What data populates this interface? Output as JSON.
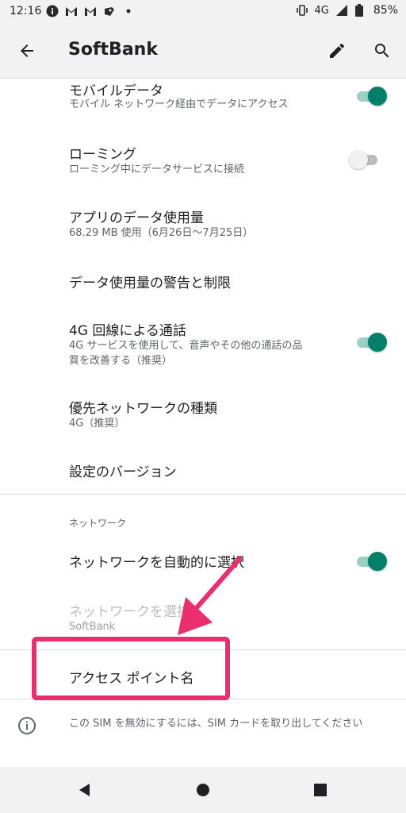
{
  "status_bar": {
    "time": "12:16",
    "network": "4G",
    "battery": "85%"
  },
  "app_bar": {
    "title": "SoftBank"
  },
  "settings": {
    "mobile_data": {
      "title": "モバイルデータ",
      "summary": "モバイル ネットワーク経由でデータにアクセス",
      "enabled": true
    },
    "roaming": {
      "title": "ローミング",
      "summary": "ローミング中にデータサービスに接続",
      "enabled": false
    },
    "app_data_usage": {
      "title": "アプリのデータ使用量",
      "summary": "68.29 MB 使用（6月26日〜7月25日）"
    },
    "data_warning": {
      "title": "データ使用量の警告と制限"
    },
    "volte": {
      "title": "4G 回線による通話",
      "summary_line1": "4G サービスを使用して、音声やその他の通話の品",
      "summary_line2": "質を改善する（推奨）",
      "enabled": true
    },
    "preferred_network": {
      "title": "優先ネットワークの種類",
      "summary": "4G（推奨）"
    },
    "settings_version": {
      "title": "設定のバージョン"
    }
  },
  "network_section": {
    "header": "ネットワーク",
    "auto_select": {
      "title": "ネットワークを自動的に選択",
      "enabled": true
    },
    "choose_network": {
      "title": "ネットワークを選択",
      "summary": "SoftBank"
    },
    "access_point_names": {
      "title": "アクセス ポイント名"
    }
  },
  "info": {
    "text": "この SIM を無効にするには、SIM カードを取り出してください"
  },
  "annotation": {
    "color": "#ea2e6e"
  },
  "colors": {
    "accent": "#00806b",
    "accent_track": "#9cd0c4"
  }
}
